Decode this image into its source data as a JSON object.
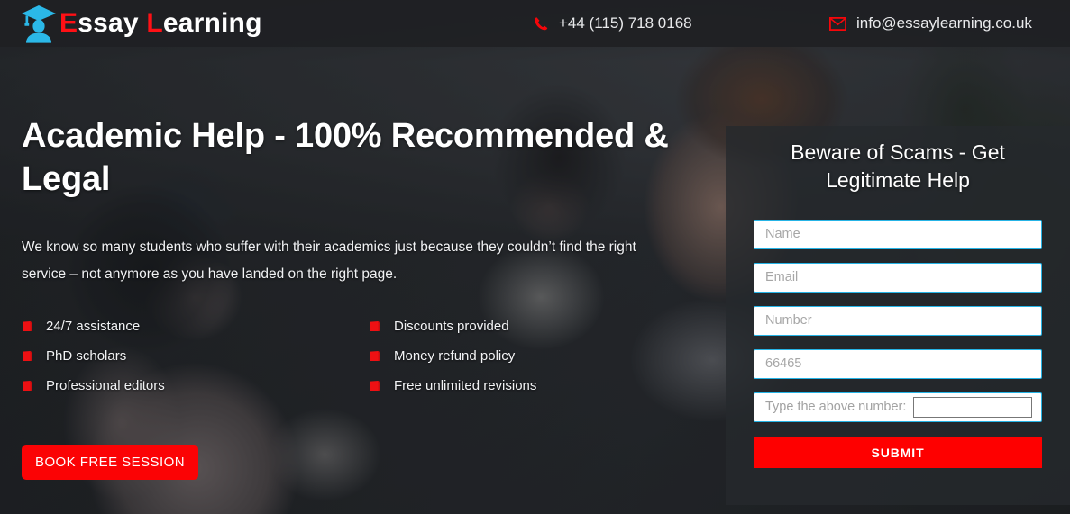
{
  "header": {
    "logo": {
      "icon": "graduate-cap-icon",
      "text_part_1_cap": "E",
      "text_part_1_rest": "ssay",
      "text_part_2_cap": "L",
      "text_part_2_rest": "earning",
      "icon_color": "#2bb8e8",
      "cap_color": "#ff1015"
    },
    "phone": {
      "icon": "phone-icon",
      "value": "+44 (115) 718 0168"
    },
    "email": {
      "icon": "envelope-icon",
      "value": "info@essaylearning.co.uk"
    }
  },
  "hero": {
    "headline": "Academic Help - 100% Recommended & Legal",
    "subhead": "We know so many students who suffer with their academics just because they couldn’t find the right service – not anymore as you have landed on the right page.",
    "features": [
      {
        "icon": "red-book-icon",
        "label": "24/7 assistance"
      },
      {
        "icon": "red-book-icon",
        "label": "Discounts provided"
      },
      {
        "icon": "red-book-icon",
        "label": "PhD scholars"
      },
      {
        "icon": "red-book-icon",
        "label": "Money refund policy"
      },
      {
        "icon": "red-book-icon",
        "label": "Professional editors"
      },
      {
        "icon": "red-book-icon",
        "label": "Free unlimited revisions"
      }
    ],
    "cta_label": "BOOK FREE SESSION",
    "cta_color": "#fb0305"
  },
  "form": {
    "title": "Beware of Scams - Get Legitimate Help",
    "name_placeholder": "Name",
    "name_value": "",
    "email_placeholder": "Email",
    "email_value": "",
    "number_placeholder": "Number",
    "number_value": "",
    "captcha_code_placeholder": "66465",
    "captcha_code_value": "",
    "captcha_label": "Type the above number:",
    "captcha_answer_value": "",
    "submit_label": "SUBMIT",
    "submit_color": "#fe0000",
    "field_border_color": "#26b4e6"
  }
}
